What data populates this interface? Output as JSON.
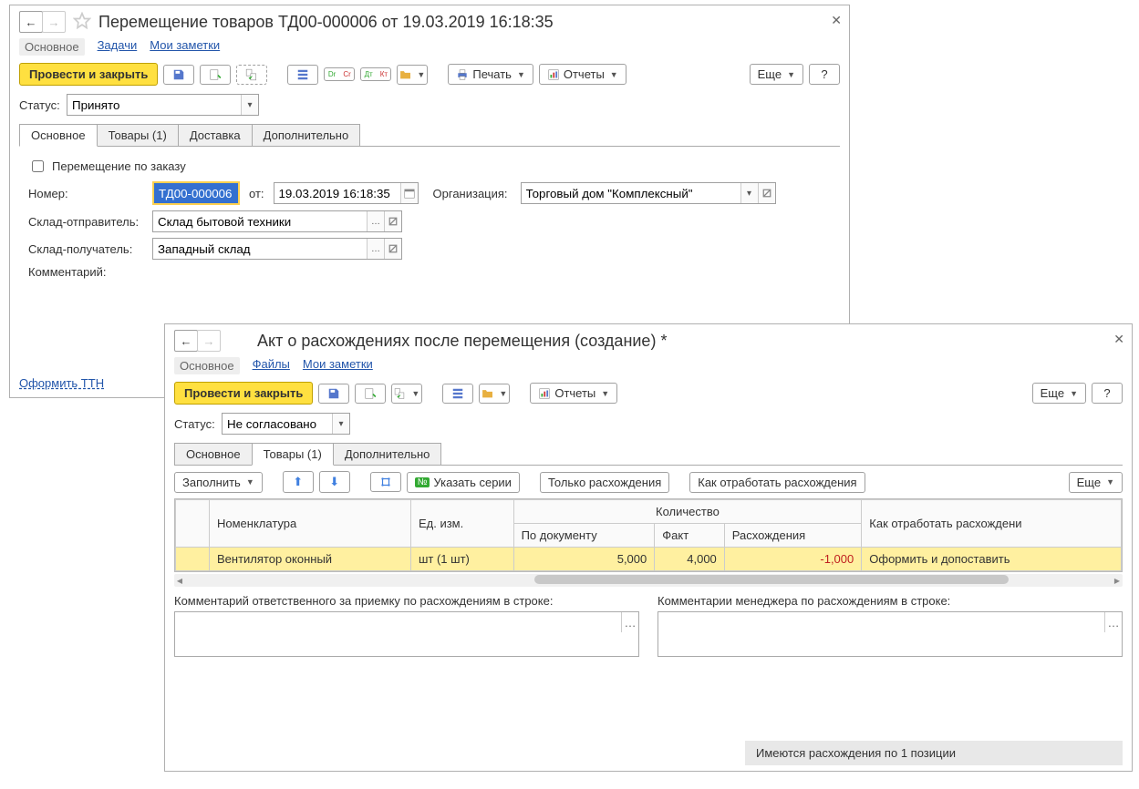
{
  "win1": {
    "title": "Перемещение товаров ТД00-000006 от 19.03.2019 16:18:35",
    "nav": {
      "main": "Основное",
      "tasks": "Задачи",
      "notes": "Мои заметки"
    },
    "toolbar": {
      "post_close": "Провести и закрыть",
      "print": "Печать",
      "reports": "Отчеты",
      "more": "Еще",
      "help": "?"
    },
    "status_label": "Статус:",
    "status_value": "Принято",
    "tabs": {
      "main": "Основное",
      "goods": "Товары (1)",
      "delivery": "Доставка",
      "addl": "Дополнительно"
    },
    "checkbox_label": "Перемещение по заказу",
    "fields": {
      "number_label": "Номер:",
      "number_value": "ТД00-000006",
      "from_label": "от:",
      "date_value": "19.03.2019 16:18:35",
      "org_label": "Организация:",
      "org_value": "Торговый дом \"Комплексный\"",
      "sender_label": "Склад-отправитель:",
      "sender_value": "Склад бытовой техники",
      "receiver_label": "Склад-получатель:",
      "receiver_value": "Западный склад",
      "comment_label": "Комментарий:"
    },
    "ttn_link": "Оформить ТТН"
  },
  "win2": {
    "title": "Акт о расхождениях после перемещения (создание) *",
    "nav": {
      "main": "Основное",
      "files": "Файлы",
      "notes": "Мои заметки"
    },
    "toolbar": {
      "post_close": "Провести и закрыть",
      "reports": "Отчеты",
      "more": "Еще",
      "help": "?"
    },
    "status_label": "Статус:",
    "status_value": "Не согласовано",
    "tabs": {
      "main": "Основное",
      "goods": "Товары (1)",
      "addl": "Дополнительно"
    },
    "tabletb": {
      "fill": "Заполнить",
      "series": "Указать серии",
      "only_diff": "Только расхождения",
      "how_handle": "Как отработать расхождения",
      "more": "Еще"
    },
    "columns": {
      "nomenclature": "Номенклатура",
      "unit": "Ед. изм.",
      "qty": "Количество",
      "by_doc": "По документу",
      "fact": "Факт",
      "diff": "Расхождения",
      "how": "Как отработать расхождени"
    },
    "row": {
      "nomenclature": "Вентилятор оконный",
      "unit": "шт (1 шт)",
      "by_doc": "5,000",
      "fact": "4,000",
      "diff": "-1,000",
      "how": "Оформить и допоставить"
    },
    "comments": {
      "resp": "Комментарий ответственного за приемку по расхождениям в строке:",
      "mgr": "Комментарии менеджера по расхождениям в строке:"
    },
    "statusbar": "Имеются расхождения по 1 позиции"
  }
}
